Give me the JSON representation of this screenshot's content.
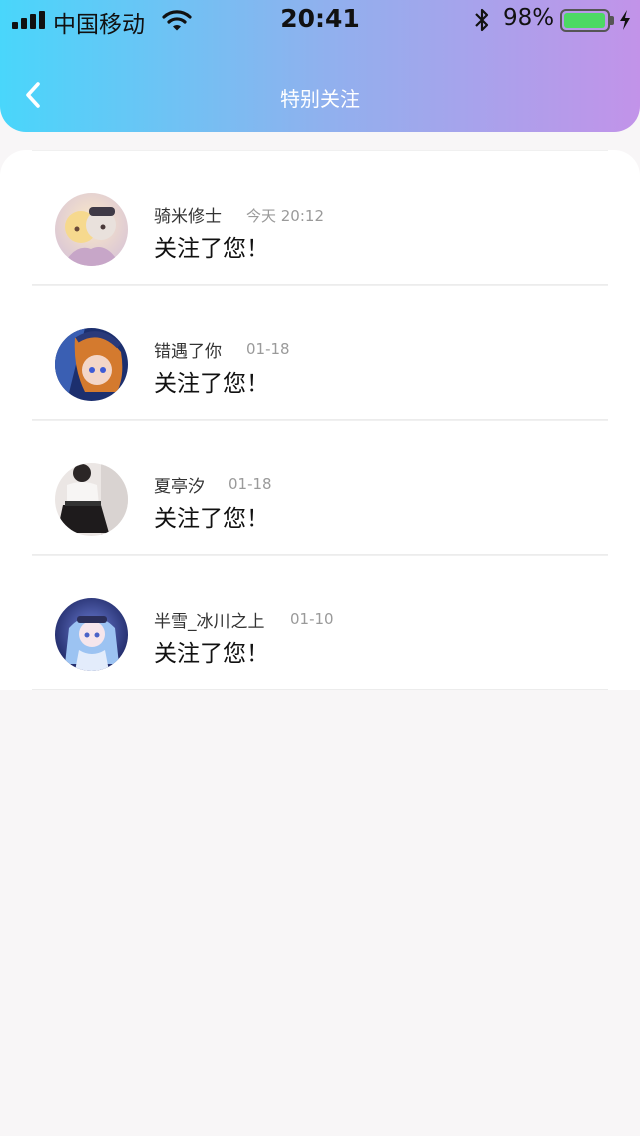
{
  "status_bar": {
    "carrier": "中国移动",
    "time": "20:41",
    "battery_percent": "98%",
    "battery_level": 0.98
  },
  "nav": {
    "title": "特别关注"
  },
  "notifications": [
    {
      "name": "骑米修士",
      "time": "今天 20:12",
      "message": "关注了您！"
    },
    {
      "name": "错遇了你",
      "time": "01-18",
      "message": "关注了您！"
    },
    {
      "name": "夏亭汐",
      "time": "01-18",
      "message": "关注了您！"
    },
    {
      "name": "半雪_冰川之上",
      "time": "01-10",
      "message": "关注了您！"
    }
  ],
  "colors": {
    "header_gradient": [
      "#49d6fb",
      "#8fb1ee",
      "#c293e9"
    ],
    "page_background": "#f8f6f7",
    "battery_green": "#4cd964"
  },
  "icons": [
    "signal-icon",
    "wifi-icon",
    "bluetooth-icon",
    "battery-icon",
    "charging-icon",
    "back-arrow-icon"
  ]
}
